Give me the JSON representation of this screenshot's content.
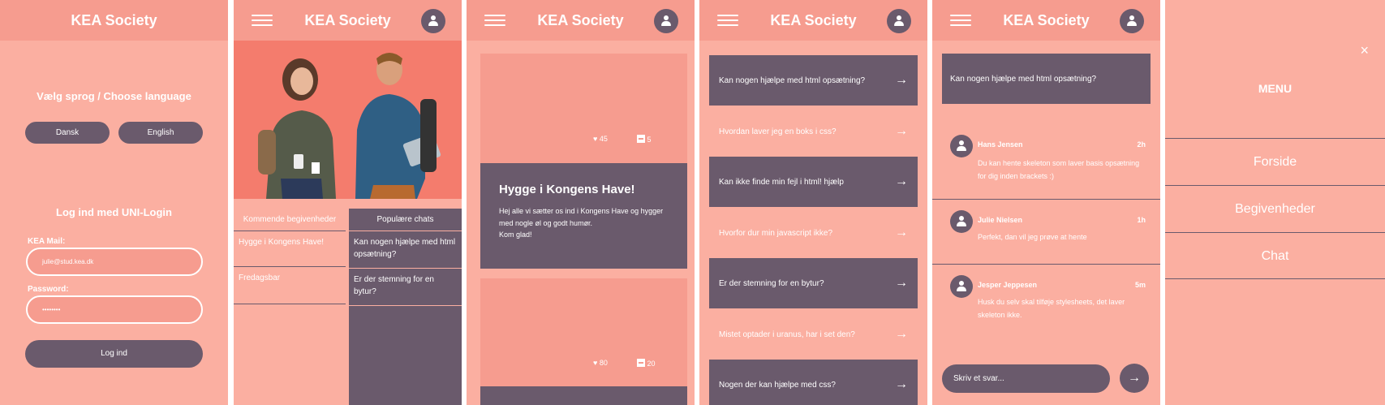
{
  "app": {
    "title": "KEA Society"
  },
  "colors": {
    "background": "#fbafa1",
    "header": "#f69c8f",
    "accent": "#6a5a6c",
    "hero": "#f47c6d"
  },
  "login": {
    "language_prompt": "Vælg sprog / Choose language",
    "lang_buttons": [
      "Dansk",
      "English"
    ],
    "login_title": "Log ind med UNI-Login",
    "mail_label": "KEA Mail:",
    "mail_value": "julie@stud.kea.dk",
    "password_label": "Password:",
    "password_value": "••••••••",
    "submit": "Log ind"
  },
  "home": {
    "col_events_header": "Kommende begivenheder",
    "col_chats_header": "Populære chats",
    "events": [
      "Hygge i Kongens Have!",
      "Fredagsbar"
    ],
    "chats": [
      "Kan nogen hjælpe med html opsætning?",
      "Er der stemning for en bytur?"
    ]
  },
  "events_screen": {
    "card1": {
      "likes": "45",
      "comments": "5"
    },
    "featured": {
      "title": "Hygge i Kongens Have!",
      "body": "Hej alle vi sætter os ind i Kongens Have og hygger med nogle øl og godt humør.",
      "cta": "Kom glad!"
    },
    "card2": {
      "likes": "80",
      "comments": "20"
    }
  },
  "chat_list": {
    "questions": [
      "Kan nogen hjælpe med html opsætning?",
      "Hvordan laver jeg en boks i css?",
      "Kan ikke finde min fejl i html! hjælp",
      "Hvorfor dur min javascript ikke?",
      "Er der stemning for en bytur?",
      "Mistet optader i uranus, har i set den?",
      "Nogen der kan hjælpe med css?"
    ]
  },
  "chat_detail": {
    "question": "Kan nogen hjælpe med html opsætning?",
    "messages": [
      {
        "name": "Hans Jensen",
        "time": "2h",
        "text": "Du kan hente skeleton som laver basis opsætning for dig inden brackets :)"
      },
      {
        "name": "Julie Nielsen",
        "time": "1h",
        "text": "Perfekt, dan vil jeg prøve at hente"
      },
      {
        "name": "Jesper Jeppesen",
        "time": "5m",
        "text": "Husk du selv skal tilføje stylesheets, det laver skeleton ikke."
      }
    ],
    "reply_placeholder": "Skriv et svar..."
  },
  "menu": {
    "title": "MENU",
    "close": "×",
    "items": [
      "Forside",
      "Begivenheder",
      "Chat"
    ]
  },
  "icons": {
    "arrow": "→",
    "hamburger": "hamburger-icon",
    "profile": "profile-icon",
    "heart": "heart-icon",
    "comment": "comment-icon"
  }
}
